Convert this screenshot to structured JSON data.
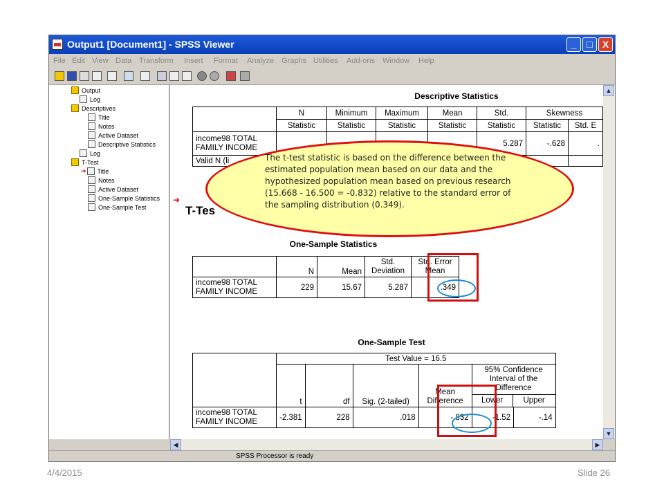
{
  "window": {
    "title": "Output1 [Document1] - SPSS Viewer",
    "controls": [
      "_",
      "□",
      "X"
    ]
  },
  "menu": [
    "File",
    "Edit",
    "View",
    "Data",
    "Transform",
    "Insert",
    "Format",
    "Analyze",
    "Graphs",
    "Utilities",
    "Add-ons",
    "Window",
    "Help"
  ],
  "outline": {
    "items": [
      "Output",
      "Log",
      "Descriptives",
      "Title",
      "Notes",
      "Active Dataset",
      "Descriptive Statistics",
      "Log",
      "T-Test",
      "Title",
      "Notes",
      "Active Dataset",
      "One-Sample Statistics",
      "One-Sample Test"
    ]
  },
  "descriptives": {
    "title": "Descriptive Statistics",
    "headers": [
      "N",
      "Minimum",
      "Maximum",
      "Mean",
      "Std.",
      "Skewness"
    ],
    "subheaders": [
      "Statistic",
      "Statistic",
      "Statistic",
      "Statistic",
      "Statistic",
      "Statistic",
      "Std. E"
    ],
    "row_label": "income98 TOTAL FAMILY INCOME",
    "valid_label": "Valid N (li",
    "std": "5.287",
    "skew": "-.628",
    "skew_se": "."
  },
  "ttest_heading": "T-Tes",
  "one_sample_stats": {
    "title": "One-Sample Statistics",
    "headers": [
      "N",
      "Mean",
      "Std. Deviation",
      "Std. Error Mean"
    ],
    "row_label": "income98 TOTAL FAMILY INCOME",
    "values": [
      "229",
      "15.67",
      "5.287",
      ".349"
    ]
  },
  "one_sample_test": {
    "title": "One-Sample Test",
    "test_value": "Test Value = 16.5",
    "ci_header": "95% Confidence Interval of the Difference",
    "headers": [
      "t",
      "df",
      "Sig. (2-tailed)",
      "Mean Difference",
      "Lower",
      "Upper"
    ],
    "row_label": "income98 TOTAL FAMILY INCOME",
    "values": [
      "-2.381",
      "228",
      ".018",
      "-.832",
      "-1.52",
      "-.14"
    ]
  },
  "callout": "The t-test statistic is based on the difference between the estimated population mean based on our data and the hypothesized population mean based on previous research (15.668 - 16.500 = -0.832) relative to the standard error of the sampling distribution  (0.349).",
  "status": "SPSS Processor is ready",
  "slide": {
    "date": "4/4/2015",
    "number": "Slide 26"
  }
}
